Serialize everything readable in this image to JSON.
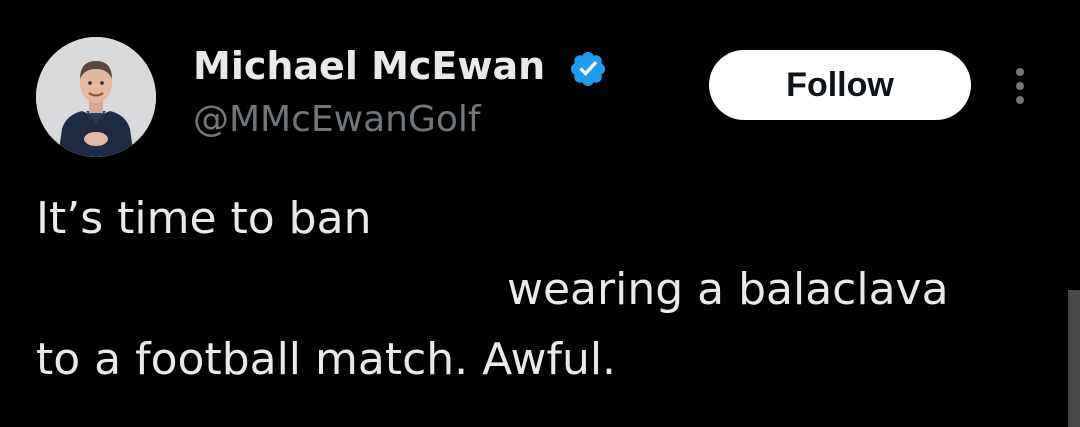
{
  "author": {
    "display_name": "Michael McEwan",
    "handle": "@MMcEwanGolf",
    "verified": true,
    "avatar_icon": "profile-photo"
  },
  "actions": {
    "follow_label": "Follow",
    "more_icon": "more-vertical-icon"
  },
  "tweet": {
    "lines": [
      "It’s time to ban",
      "wearing a balaclava",
      "to a football match.  Awful."
    ]
  },
  "colors": {
    "background": "#000000",
    "text_primary": "#e7e9ea",
    "text_secondary": "#71767b",
    "verified_blue": "#1d9bf0",
    "follow_bg": "#ffffff",
    "follow_text": "#0f1419"
  }
}
